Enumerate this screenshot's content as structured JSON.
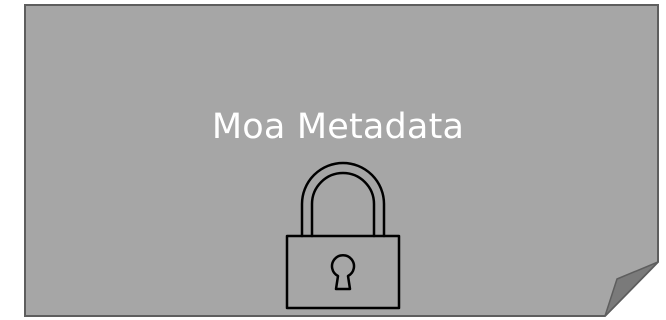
{
  "note": {
    "title": "Moa Metadata",
    "icon": "lock-icon",
    "colors": {
      "fill": "#a6a6a6",
      "border": "#5e5e5e",
      "fold": "#7a7a7a",
      "title": "#ffffff",
      "icon_stroke": "#000000"
    }
  }
}
